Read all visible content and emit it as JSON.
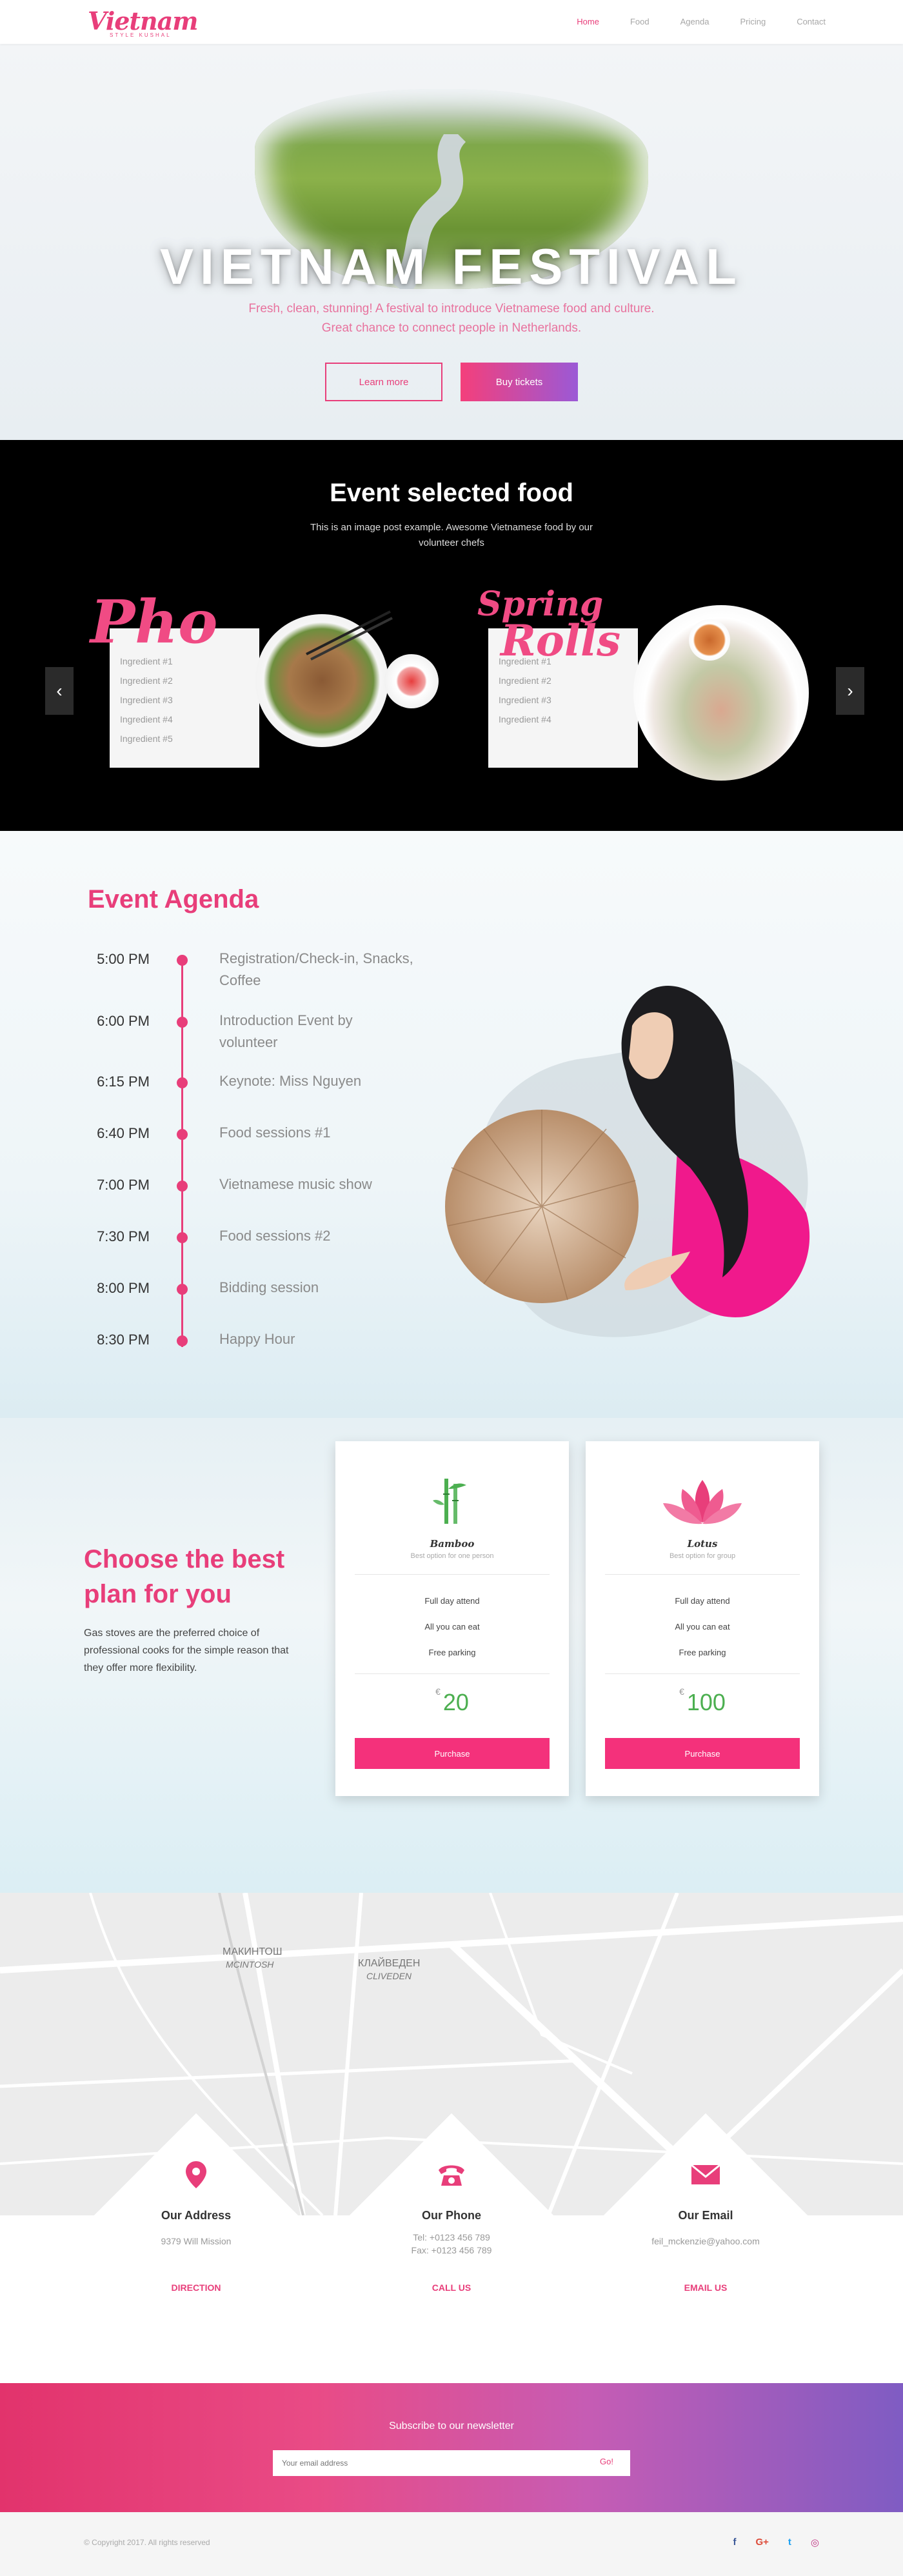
{
  "nav": {
    "logo": "Vietnam",
    "logo_sub": "STYLE KUSHAL",
    "links": [
      "Home",
      "Food",
      "Agenda",
      "Pricing",
      "Contact"
    ],
    "active": "Home"
  },
  "hero": {
    "title": "VIETNAM FESTIVAL",
    "subtitle_line1": "Fresh, clean, stunning! A festival to introduce Vietnamese food and culture.",
    "subtitle_line2": "Great chance to connect people in Netherlands.",
    "learn_more": "Learn more",
    "buy_tickets": "Buy tickets"
  },
  "food": {
    "title": "Event selected food",
    "subtitle_line1": "This is an image post example. Awesome Vietnamese food by our",
    "subtitle_line2": "volunteer chefs",
    "items": [
      {
        "name": "Pho",
        "ingredients": [
          "Ingredient #1",
          "Ingredient #2",
          "Ingredient #3",
          "Ingredient #4",
          "Ingredient #5"
        ]
      },
      {
        "name_line1": "Spring",
        "name_line2": "Rolls",
        "ingredients": [
          "Ingredient #1",
          "Ingredient #2",
          "Ingredient #3",
          "Ingredient #4"
        ]
      }
    ],
    "prev_arrow": "‹",
    "next_arrow": "›"
  },
  "agenda": {
    "title": "Event Agenda",
    "items": [
      {
        "time": "5:00 PM",
        "event": "Registration/Check-in, Snacks, Coffee"
      },
      {
        "time": "6:00 PM",
        "event": "Introduction Event by volunteer"
      },
      {
        "time": "6:15 PM",
        "event": "Keynote: Miss Nguyen"
      },
      {
        "time": "6:40 PM",
        "event": "Food sessions #1"
      },
      {
        "time": "7:00 PM",
        "event": "Vietnamese music show"
      },
      {
        "time": "7:30 PM",
        "event": "Food sessions #2"
      },
      {
        "time": "8:00 PM",
        "event": "Bidding session"
      },
      {
        "time": "8:30 PM",
        "event": "Happy Hour"
      }
    ]
  },
  "pricing": {
    "title_line1": "Choose the best",
    "title_line2": "plan for you",
    "description": "Gas stoves are the preferred choice of professional cooks for the simple reason that they offer more flexibility.",
    "plans": [
      {
        "name": "Bamboo",
        "best": "Best option for one person",
        "features": [
          "Full day attend",
          "All you can eat",
          "Free parking"
        ],
        "currency": "€",
        "price": "20",
        "button": "Purchase",
        "icon": "bamboo-icon",
        "icon_color": "#4caf50"
      },
      {
        "name": "Lotus",
        "best": "Best option for group",
        "features": [
          "Full day attend",
          "All you can eat",
          "Free parking"
        ],
        "currency": "€",
        "price": "100",
        "button": "Purchase",
        "icon": "lotus-icon",
        "icon_color": "#e83e7a"
      }
    ]
  },
  "contact": {
    "map_labels": [
      "МАКИНТОШ",
      "MCINTOSH",
      "КЛАЙВЕДЕН",
      "CLIVEDEN"
    ],
    "cards": [
      {
        "title": "Our Address",
        "lines": [
          "9379 Will Mission"
        ],
        "link": "DIRECTION",
        "icon": "map-pin-icon"
      },
      {
        "title": "Our Phone",
        "lines": [
          "Tel: +0123 456 789",
          "Fax: +0123 456 789"
        ],
        "link": "CALL US",
        "icon": "phone-icon"
      },
      {
        "title": "Our Email",
        "lines": [
          "feil_mckenzie@yahoo.com"
        ],
        "link": "EMAIL US",
        "icon": "envelope-icon"
      }
    ]
  },
  "newsletter": {
    "title": "Subscribe to our newsletter",
    "placeholder": "Your email address",
    "go": "Go!"
  },
  "footer": {
    "copyright": "© Copyright 2017. All rights reserved",
    "socials": [
      {
        "label": "f",
        "icon": "facebook-icon",
        "color": "#3b5998"
      },
      {
        "label": "G+",
        "icon": "google-plus-icon",
        "color": "#dd4b39"
      },
      {
        "label": "t",
        "icon": "twitter-icon",
        "color": "#1da1f2"
      },
      {
        "label": "◎",
        "icon": "instagram-icon",
        "color": "#c13584"
      }
    ]
  },
  "colors": {
    "accent": "#e83e7a",
    "price": "#4caf50"
  }
}
